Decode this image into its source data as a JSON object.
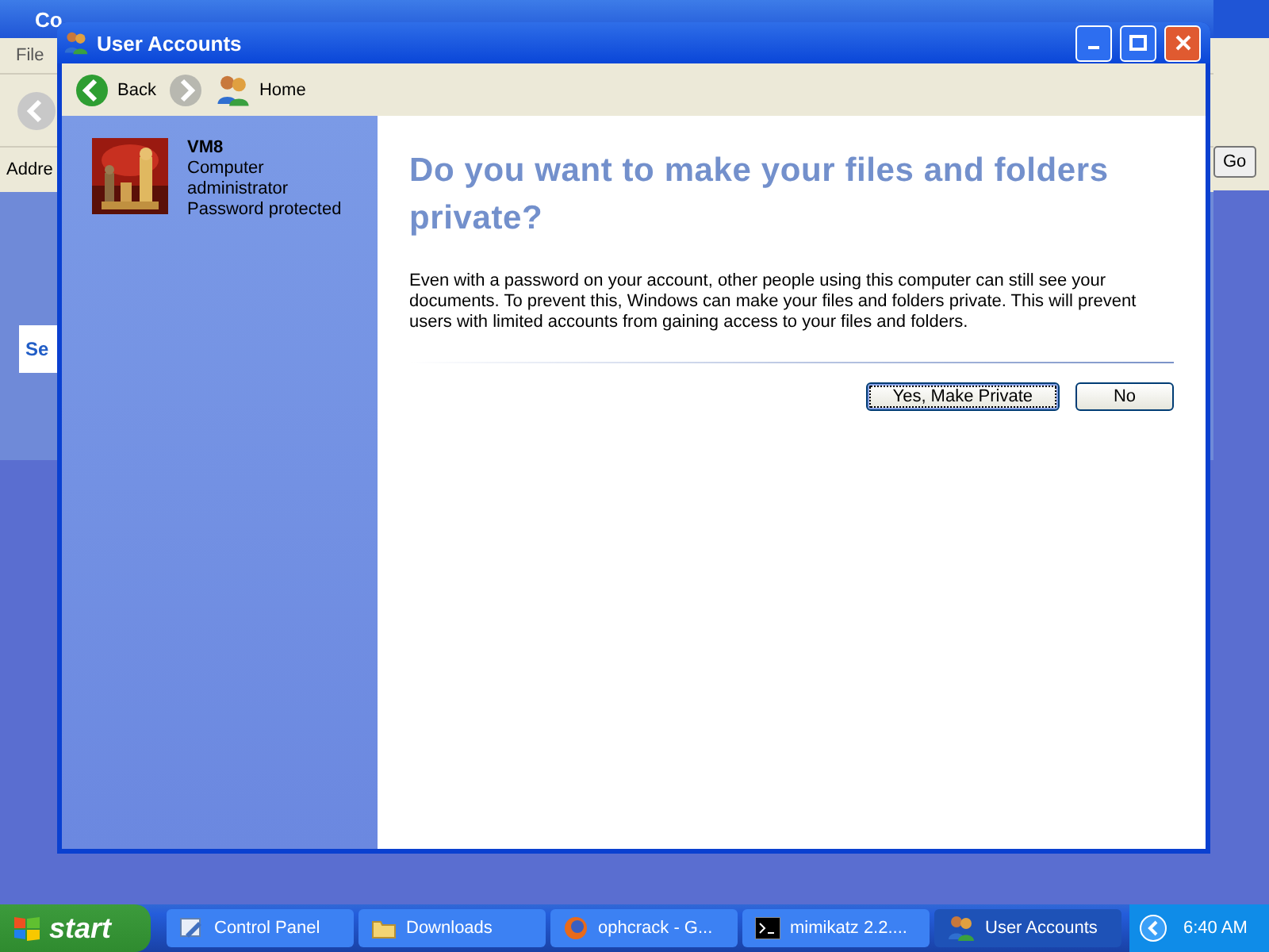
{
  "background_window": {
    "title": "Co",
    "menu": [
      "File"
    ],
    "address_label": "Addre",
    "go_button": "Go",
    "task_heading": "Se"
  },
  "window": {
    "title": "User Accounts"
  },
  "toolbar": {
    "back": "Back",
    "home": "Home"
  },
  "account": {
    "name": "VM8",
    "role": "Computer administrator",
    "status": "Password protected"
  },
  "dialog": {
    "heading": "Do you want to make your files and folders private?",
    "body": "Even with a password on your account, other people using this computer can still see your documents. To prevent this, Windows can make your files and folders private. This will prevent users with limited accounts from gaining access to your files and folders.",
    "buttons": [
      {
        "label": "Yes, Make Private",
        "focused": true
      },
      {
        "label": "No",
        "focused": false
      }
    ]
  },
  "taskbar": {
    "start": "start",
    "items": [
      {
        "label": "Control Panel",
        "kind": "control",
        "selected": false
      },
      {
        "label": "Downloads",
        "kind": "folder",
        "selected": false
      },
      {
        "label": "ophcrack - G...",
        "kind": "browser",
        "selected": false
      },
      {
        "label": "mimikatz 2.2....",
        "kind": "console",
        "selected": false
      },
      {
        "label": "User Accounts",
        "kind": "users",
        "selected": true
      }
    ],
    "clock": "6:40 AM"
  }
}
